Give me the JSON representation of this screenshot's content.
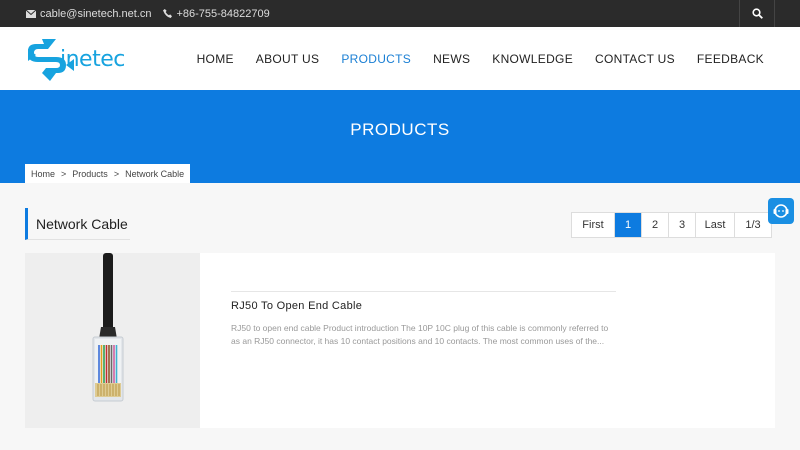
{
  "topbar": {
    "email": "cable@sinetech.net.cn",
    "phone": "+86-755-84822709",
    "search_icon": "search-icon"
  },
  "logo": {
    "text": "inetec"
  },
  "nav": {
    "items": [
      {
        "label": "HOME"
      },
      {
        "label": "ABOUT US"
      },
      {
        "label": "PRODUCTS"
      },
      {
        "label": "NEWS"
      },
      {
        "label": "KNOWLEDGE"
      },
      {
        "label": "CONTACT US"
      },
      {
        "label": "FEEDBACK"
      }
    ],
    "active": "PRODUCTS"
  },
  "banner": {
    "title": "PRODUCTS"
  },
  "breadcrumb": {
    "items": [
      "Home",
      "Products",
      "Network Cable"
    ],
    "separator": ">"
  },
  "section": {
    "title": "Network Cable"
  },
  "pagination": {
    "first": "First",
    "pages": [
      "1",
      "2",
      "3"
    ],
    "current": "1",
    "last": "Last",
    "total": "1/3"
  },
  "products": [
    {
      "title": "RJ50 To Open End Cable",
      "description": "RJ50 to open end cable Product introduction The 10P 10C plug of this cable is commonly referred to as an RJ50 connector, it has 10 contact positions and 10 contacts. The most common uses of the..."
    }
  ],
  "colors": {
    "accent": "#0d7be0",
    "topbar": "#2b2b2b",
    "logo": "#17a3df"
  }
}
